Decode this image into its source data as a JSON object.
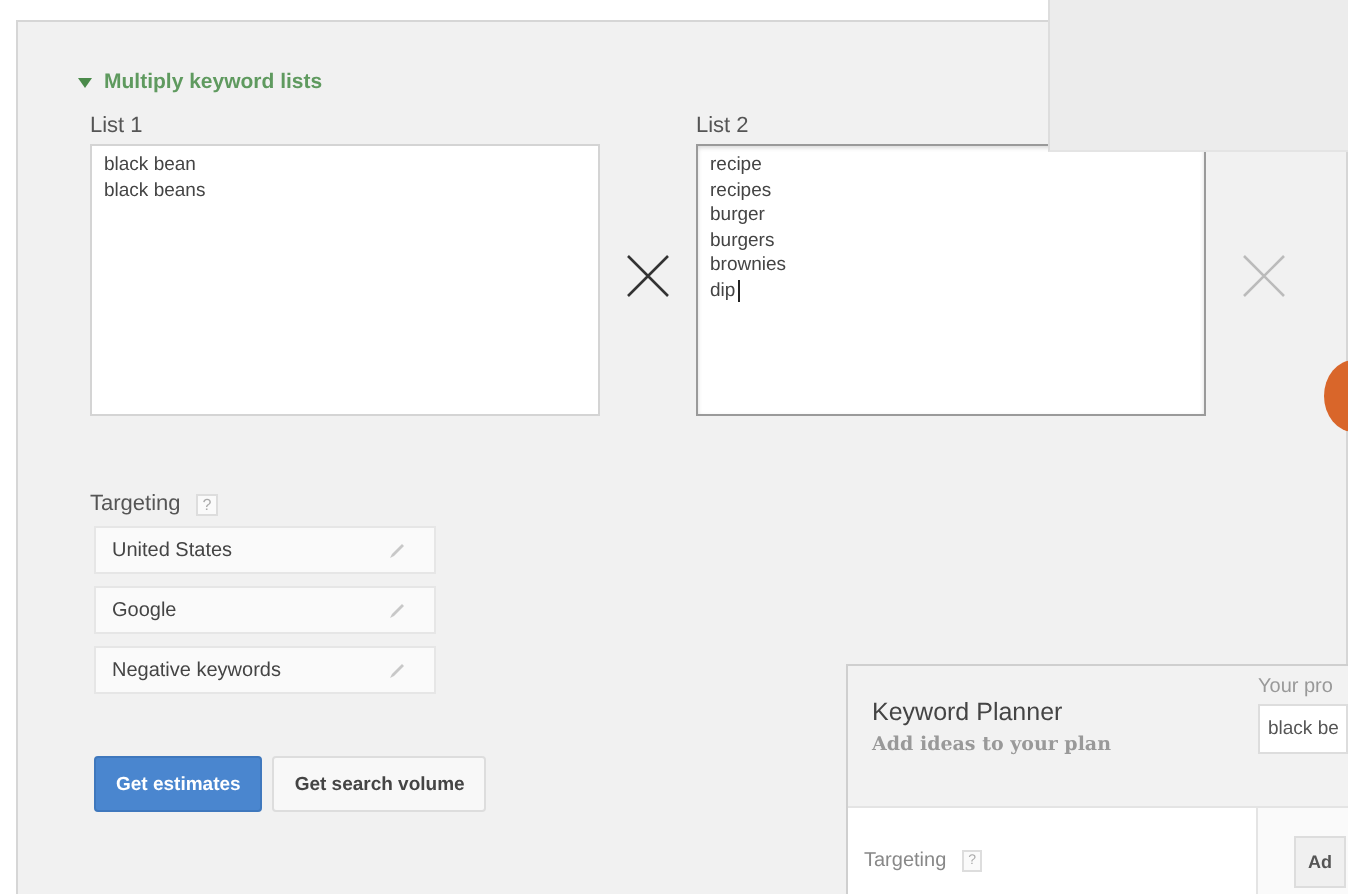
{
  "section": {
    "title": "Multiply keyword lists",
    "expanded": true
  },
  "lists": [
    {
      "label": "List 1",
      "keywords": [
        "black bean",
        "black beans"
      ],
      "focused": false
    },
    {
      "label": "List 2",
      "keywords": [
        "recipe",
        "recipes",
        "burger",
        "burgers",
        "brownies",
        "dip"
      ],
      "focused": true
    }
  ],
  "targeting": {
    "label": "Targeting",
    "help": "?",
    "items": [
      "United States",
      "Google",
      "Negative keywords"
    ]
  },
  "buttons": [
    {
      "label": "Get estimates",
      "kind": "primary"
    },
    {
      "label": "Get search volume",
      "kind": "secondary"
    }
  ],
  "inset": {
    "title": "Keyword Planner",
    "subtitle": "Add ideas to your plan",
    "product_label": "Your pro",
    "product_value": "black be",
    "targeting_label": "Targeting",
    "targeting_help": "?",
    "button": "Ad"
  }
}
